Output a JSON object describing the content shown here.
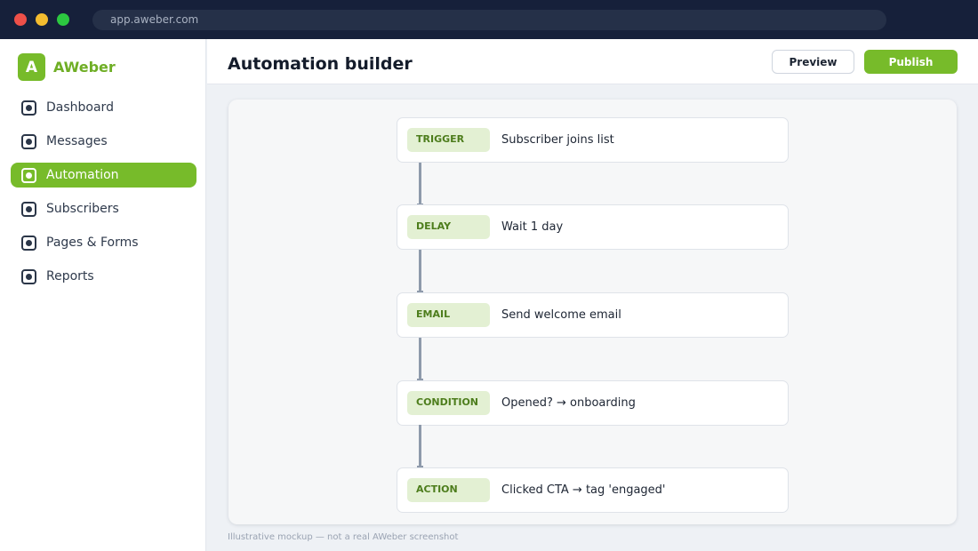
{
  "browser": {
    "url": "app.aweber.com"
  },
  "brand": {
    "initial": "A",
    "name": "AWeber",
    "color": "#77bb2a"
  },
  "sidebar": {
    "items": [
      {
        "label": "Dashboard",
        "icon": "dashboard-icon",
        "active": false
      },
      {
        "label": "Messages",
        "icon": "messages-icon",
        "active": false
      },
      {
        "label": "Automation",
        "icon": "automation-icon",
        "active": true
      },
      {
        "label": "Subscribers",
        "icon": "subscribers-icon",
        "active": false
      },
      {
        "label": "Pages & Forms",
        "icon": "pages-forms-icon",
        "active": false
      },
      {
        "label": "Reports",
        "icon": "reports-icon",
        "active": false
      }
    ]
  },
  "header": {
    "title": "Automation builder",
    "preview_label": "Preview",
    "publish_label": "Publish"
  },
  "workflow": {
    "steps": [
      {
        "tag": "TRIGGER",
        "text": "Subscriber joins list"
      },
      {
        "tag": "DELAY",
        "text": "Wait 1 day"
      },
      {
        "tag": "EMAIL",
        "text": "Send welcome email"
      },
      {
        "tag": "CONDITION",
        "text": "Opened? → onboarding"
      },
      {
        "tag": "ACTION",
        "text": "Clicked CTA → tag 'engaged'"
      }
    ]
  },
  "footer": {
    "note": "Illustrative mockup — not a real AWeber screenshot"
  }
}
